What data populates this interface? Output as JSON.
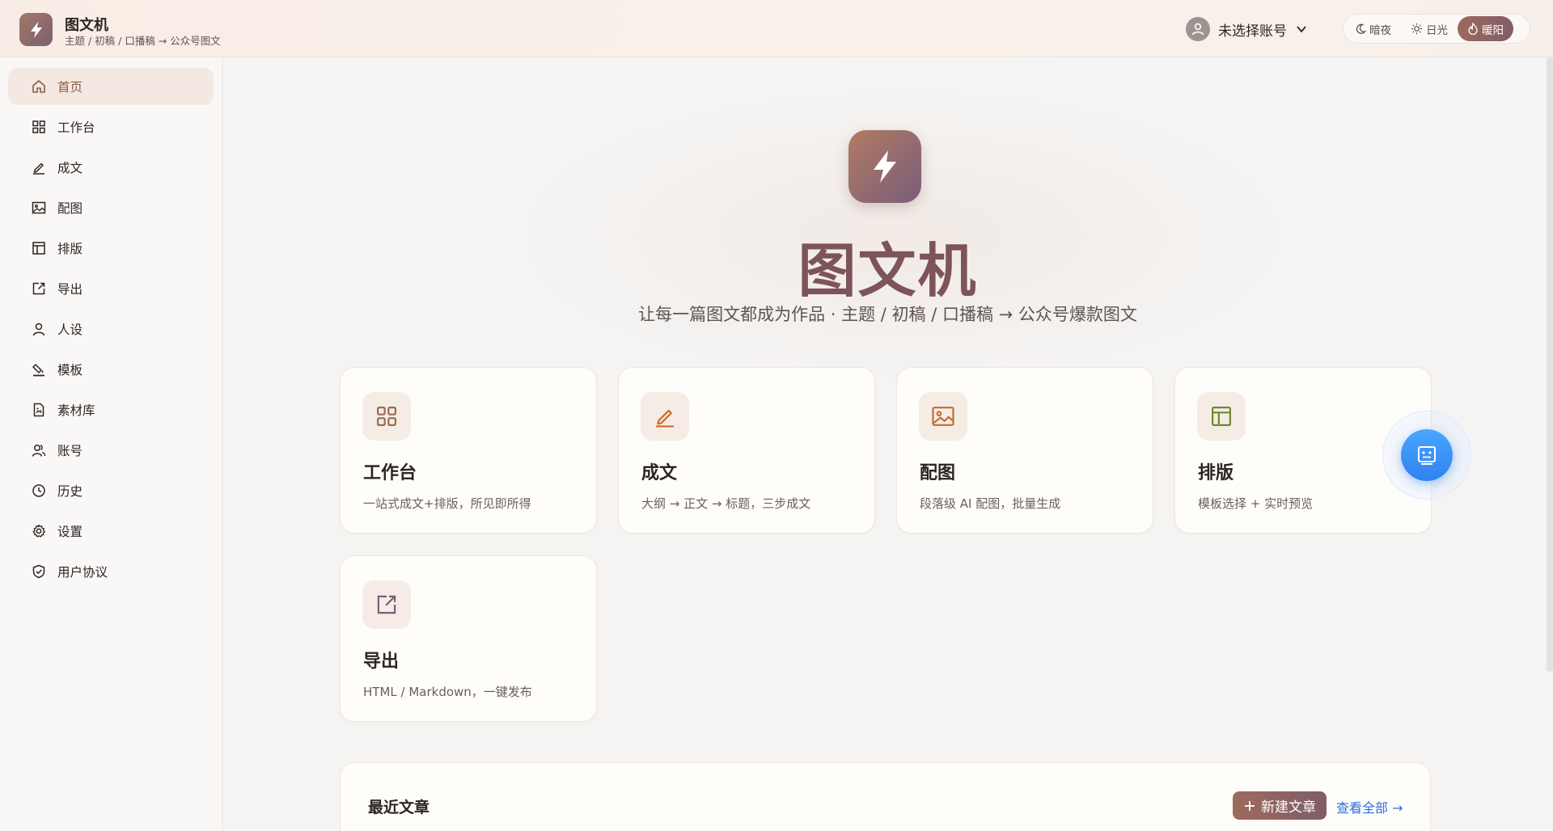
{
  "header": {
    "title": "图文机",
    "subtitle": "主题 / 初稿 / 口播稿 → 公众号图文",
    "account_label": "未选择账号",
    "themes": [
      {
        "label": "暗夜",
        "active": false
      },
      {
        "label": "日光",
        "active": false
      },
      {
        "label": "暖阳",
        "active": true
      }
    ]
  },
  "sidebar": {
    "items": [
      {
        "label": "首页",
        "icon": "home-icon",
        "active": true
      },
      {
        "label": "工作台",
        "icon": "grid-icon"
      },
      {
        "label": "成文",
        "icon": "pen-icon"
      },
      {
        "label": "配图",
        "icon": "image-icon"
      },
      {
        "label": "排版",
        "icon": "layout-icon"
      },
      {
        "label": "导出",
        "icon": "export-icon"
      },
      {
        "label": "人设",
        "icon": "user-icon"
      },
      {
        "label": "模板",
        "icon": "paint-icon"
      },
      {
        "label": "素材库",
        "icon": "file-icon"
      },
      {
        "label": "账号",
        "icon": "users-icon"
      },
      {
        "label": "历史",
        "icon": "clock-icon"
      },
      {
        "label": "设置",
        "icon": "gear-icon"
      },
      {
        "label": "用户协议",
        "icon": "shield-icon"
      }
    ]
  },
  "hero": {
    "title": "图文机",
    "subtitle": "让每一篇图文都成为作品 · 主题 / 初稿 / 口播稿 → 公众号爆款图文"
  },
  "cards": [
    {
      "title": "工作台",
      "desc": "一站式成文+排版，所见即所得",
      "icon": "grid-icon",
      "color": "#9a6a55"
    },
    {
      "title": "成文",
      "desc": "大纲 → 正文 → 标题，三步成文",
      "icon": "pen-icon",
      "color": "#d0692a"
    },
    {
      "title": "配图",
      "desc": "段落级 AI 配图，批量生成",
      "icon": "image-icon",
      "color": "#c56a30"
    },
    {
      "title": "排版",
      "desc": "模板选择 + 实时预览",
      "icon": "layout-icon",
      "color": "#6c8a2e"
    },
    {
      "title": "导出",
      "desc": "HTML / Markdown，一键发布",
      "icon": "export-icon",
      "color": "#7b5e77"
    }
  ],
  "recent": {
    "title": "最近文章",
    "new_button": "新建文章",
    "view_all": "查看全部 →"
  },
  "colors": {
    "accent": "#8f5a46",
    "hero_title": "#7d5459",
    "link": "#2d6fe0"
  }
}
